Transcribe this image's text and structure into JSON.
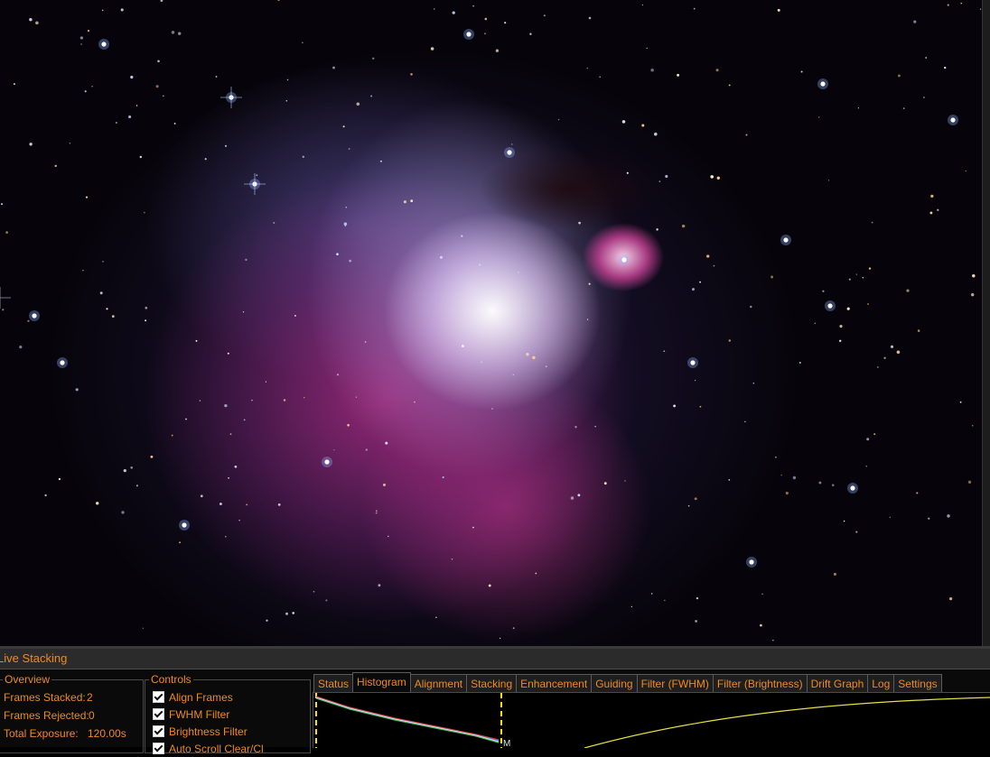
{
  "panel": {
    "title": "Live Stacking"
  },
  "overview": {
    "legend": "Overview",
    "stats": [
      {
        "label": "Frames Stacked:",
        "value": "2"
      },
      {
        "label": "Frames Rejected:",
        "value": "0"
      },
      {
        "label": "Total Exposure:",
        "value": "120.00s"
      }
    ]
  },
  "controls": {
    "legend": "Controls",
    "items": [
      {
        "label": "Align Frames",
        "checked": true
      },
      {
        "label": "FWHM Filter",
        "checked": true
      },
      {
        "label": "Brightness Filter",
        "checked": true
      },
      {
        "label": "Auto Scroll Clear/Cl",
        "checked": true
      }
    ]
  },
  "tabs": [
    {
      "label": "Status",
      "active": false
    },
    {
      "label": "Histogram",
      "active": true
    },
    {
      "label": "Alignment",
      "active": false
    },
    {
      "label": "Stacking",
      "active": false
    },
    {
      "label": "Enhancement",
      "active": false
    },
    {
      "label": "Guiding",
      "active": false
    },
    {
      "label": "Filter (FWHM)",
      "active": false
    },
    {
      "label": "Filter (Brightness)",
      "active": false
    },
    {
      "label": "Drift Graph",
      "active": false
    },
    {
      "label": "Log",
      "active": false
    },
    {
      "label": "Settings",
      "active": false
    }
  ],
  "histogram": {
    "curve_colors": {
      "red": "#e04040",
      "green": "#40c040",
      "blue": "#5080ff",
      "luma": "#e0e0e0",
      "stretch": "#e8e040"
    },
    "marker_label": "M"
  },
  "colors": {
    "accent": "#f08a1e",
    "panel_bg": "#0a0a0a",
    "title_bar": "#2b2b2b",
    "limit_line": "#ffe000"
  }
}
